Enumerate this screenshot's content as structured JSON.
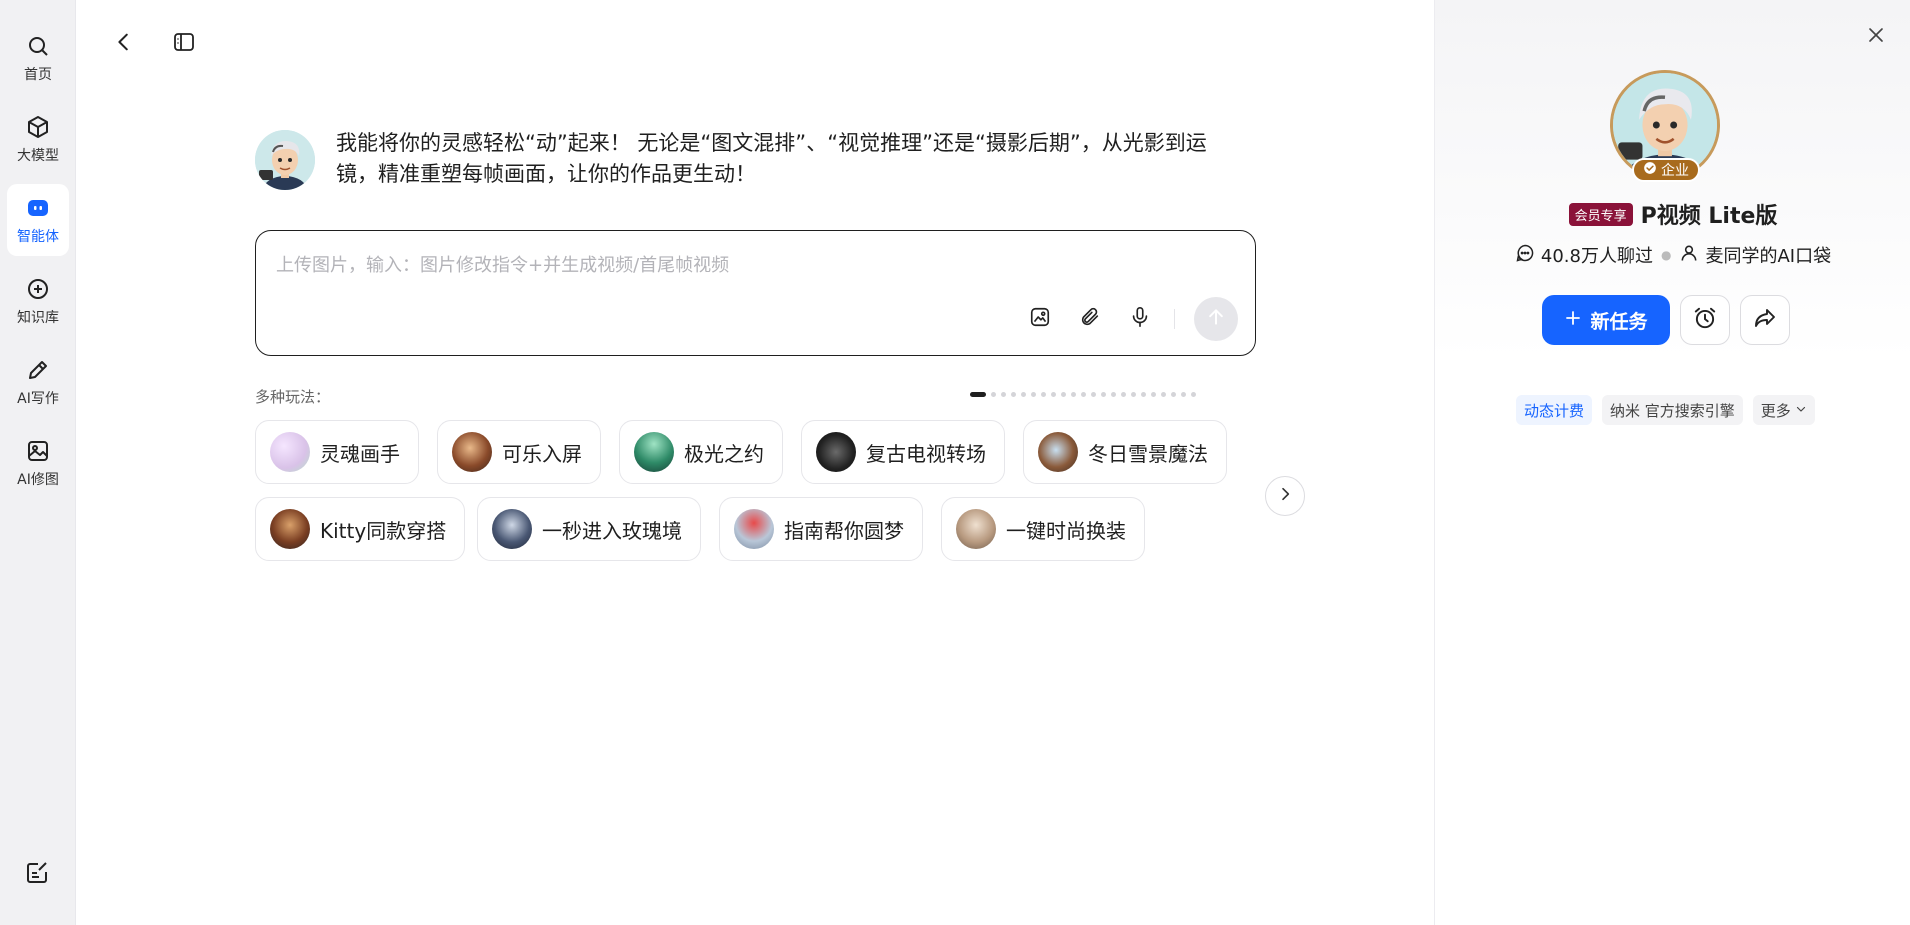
{
  "nav": {
    "items": [
      {
        "label": "首页",
        "icon": "search-icon"
      },
      {
        "label": "大模型",
        "icon": "cube-icon"
      },
      {
        "label": "智能体",
        "icon": "agent-icon",
        "active": true
      },
      {
        "label": "知识库",
        "icon": "knowledge-icon"
      },
      {
        "label": "AI写作",
        "icon": "pen-icon"
      },
      {
        "label": "AI修图",
        "icon": "image-icon"
      }
    ],
    "bottom_icon": "notes-icon"
  },
  "intro": {
    "line1": "我能将你的灵感轻松“动”起来！ 无论是“图文混排”、“视觉推理”还是“摄影后期”，从光影到运",
    "line2": "镜，精准重塑每帧画面，让你的作品更生动！"
  },
  "input": {
    "value": "",
    "placeholder": "上传图片，输入：图片修改指令+并生成视频/首尾帧视频"
  },
  "modes": {
    "label": "多种玩法：",
    "chips": [
      {
        "label": "灵魂画手"
      },
      {
        "label": "可乐入屏"
      },
      {
        "label": "极光之约"
      },
      {
        "label": "复古电视转场"
      },
      {
        "label": "冬日雪景魔法"
      },
      {
        "label": "Kitty同款穿搭"
      },
      {
        "label": "一秒进入玫瑰境"
      },
      {
        "label": "指南帮你圆梦"
      },
      {
        "label": "一键时尚换装"
      }
    ]
  },
  "panel": {
    "badge": "企业",
    "vip_tag": "会员专享",
    "title": "P视频 Lite版",
    "chats": "40.8万人聊过",
    "author": "麦同学的AI口袋",
    "new_task": "新任务",
    "tags": [
      "动态计费",
      "纳米 官方搜索引擎",
      "更多"
    ]
  },
  "colors": {
    "accent": "#1664ff",
    "vip": "#8a1239",
    "enterprise": "#a86b1d"
  }
}
